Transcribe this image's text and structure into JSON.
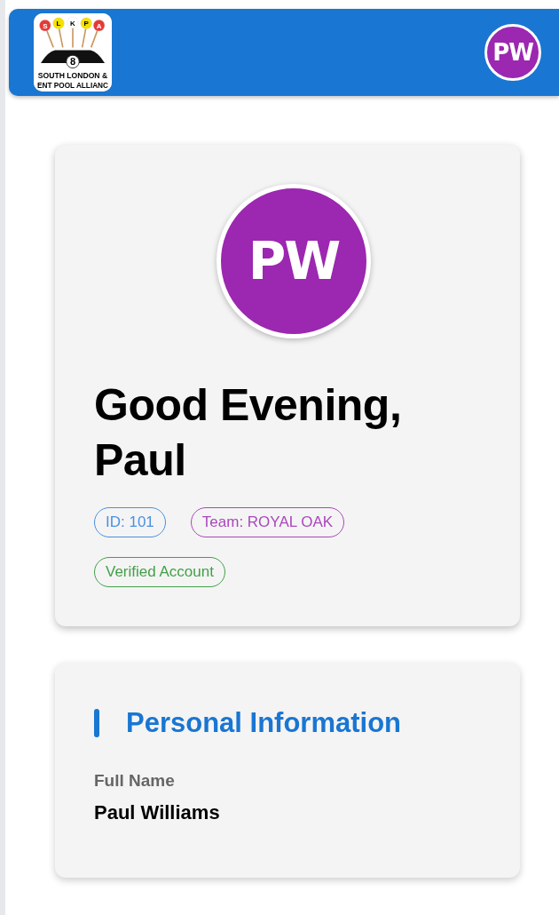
{
  "header": {
    "logo": {
      "letters": [
        "S",
        "L",
        "K",
        "P",
        "A"
      ],
      "ball": "8",
      "lines": [
        "SOUTH LONDON &",
        "ENT POOL ALLIANC"
      ]
    },
    "avatar": "PW"
  },
  "profile": {
    "avatar": "PW",
    "greeting": "Good Evening, Paul",
    "badges": [
      {
        "text": "ID: 101",
        "color": "#4a90e2"
      },
      {
        "text": "Team: ROYAL OAK",
        "color": "#ab47bc"
      },
      {
        "text": "Verified Account",
        "color": "#43a047"
      }
    ]
  },
  "personal_information": {
    "title": "Personal Information",
    "fields": [
      {
        "label": "Full Name",
        "value": "Paul Williams"
      }
    ]
  }
}
